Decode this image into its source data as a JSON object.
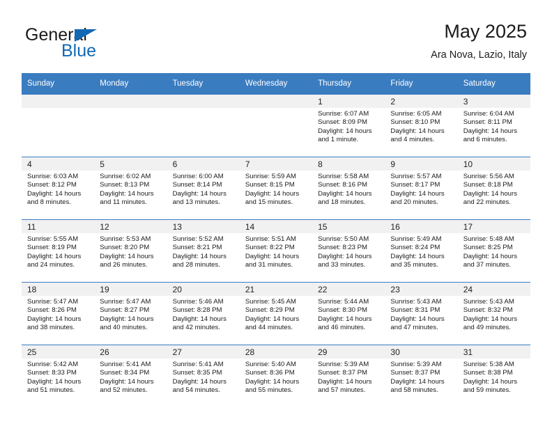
{
  "brand": {
    "name_top": "General",
    "name_bottom": "Blue",
    "accent_color": "#1368b4"
  },
  "header": {
    "title": "May 2025",
    "subtitle": "Ara Nova, Lazio, Italy"
  },
  "theme": {
    "header_bar_color": "#3a7cc0",
    "daynum_band_color": "#f1f1f1",
    "grid_line_color": "#3a7cc0"
  },
  "weekday_headers": [
    "Sunday",
    "Monday",
    "Tuesday",
    "Wednesday",
    "Thursday",
    "Friday",
    "Saturday"
  ],
  "weeks": [
    [
      {
        "day": "",
        "sunrise": "",
        "sunset": "",
        "daylight_line1": "",
        "daylight_line2": "",
        "empty": true
      },
      {
        "day": "",
        "sunrise": "",
        "sunset": "",
        "daylight_line1": "",
        "daylight_line2": "",
        "empty": true
      },
      {
        "day": "",
        "sunrise": "",
        "sunset": "",
        "daylight_line1": "",
        "daylight_line2": "",
        "empty": true
      },
      {
        "day": "",
        "sunrise": "",
        "sunset": "",
        "daylight_line1": "",
        "daylight_line2": "",
        "empty": true
      },
      {
        "day": "1",
        "sunrise": "Sunrise: 6:07 AM",
        "sunset": "Sunset: 8:09 PM",
        "daylight_line1": "Daylight: 14 hours",
        "daylight_line2": "and 1 minute.",
        "empty": false
      },
      {
        "day": "2",
        "sunrise": "Sunrise: 6:05 AM",
        "sunset": "Sunset: 8:10 PM",
        "daylight_line1": "Daylight: 14 hours",
        "daylight_line2": "and 4 minutes.",
        "empty": false
      },
      {
        "day": "3",
        "sunrise": "Sunrise: 6:04 AM",
        "sunset": "Sunset: 8:11 PM",
        "daylight_line1": "Daylight: 14 hours",
        "daylight_line2": "and 6 minutes.",
        "empty": false
      }
    ],
    [
      {
        "day": "4",
        "sunrise": "Sunrise: 6:03 AM",
        "sunset": "Sunset: 8:12 PM",
        "daylight_line1": "Daylight: 14 hours",
        "daylight_line2": "and 8 minutes.",
        "empty": false
      },
      {
        "day": "5",
        "sunrise": "Sunrise: 6:02 AM",
        "sunset": "Sunset: 8:13 PM",
        "daylight_line1": "Daylight: 14 hours",
        "daylight_line2": "and 11 minutes.",
        "empty": false
      },
      {
        "day": "6",
        "sunrise": "Sunrise: 6:00 AM",
        "sunset": "Sunset: 8:14 PM",
        "daylight_line1": "Daylight: 14 hours",
        "daylight_line2": "and 13 minutes.",
        "empty": false
      },
      {
        "day": "7",
        "sunrise": "Sunrise: 5:59 AM",
        "sunset": "Sunset: 8:15 PM",
        "daylight_line1": "Daylight: 14 hours",
        "daylight_line2": "and 15 minutes.",
        "empty": false
      },
      {
        "day": "8",
        "sunrise": "Sunrise: 5:58 AM",
        "sunset": "Sunset: 8:16 PM",
        "daylight_line1": "Daylight: 14 hours",
        "daylight_line2": "and 18 minutes.",
        "empty": false
      },
      {
        "day": "9",
        "sunrise": "Sunrise: 5:57 AM",
        "sunset": "Sunset: 8:17 PM",
        "daylight_line1": "Daylight: 14 hours",
        "daylight_line2": "and 20 minutes.",
        "empty": false
      },
      {
        "day": "10",
        "sunrise": "Sunrise: 5:56 AM",
        "sunset": "Sunset: 8:18 PM",
        "daylight_line1": "Daylight: 14 hours",
        "daylight_line2": "and 22 minutes.",
        "empty": false
      }
    ],
    [
      {
        "day": "11",
        "sunrise": "Sunrise: 5:55 AM",
        "sunset": "Sunset: 8:19 PM",
        "daylight_line1": "Daylight: 14 hours",
        "daylight_line2": "and 24 minutes.",
        "empty": false
      },
      {
        "day": "12",
        "sunrise": "Sunrise: 5:53 AM",
        "sunset": "Sunset: 8:20 PM",
        "daylight_line1": "Daylight: 14 hours",
        "daylight_line2": "and 26 minutes.",
        "empty": false
      },
      {
        "day": "13",
        "sunrise": "Sunrise: 5:52 AM",
        "sunset": "Sunset: 8:21 PM",
        "daylight_line1": "Daylight: 14 hours",
        "daylight_line2": "and 28 minutes.",
        "empty": false
      },
      {
        "day": "14",
        "sunrise": "Sunrise: 5:51 AM",
        "sunset": "Sunset: 8:22 PM",
        "daylight_line1": "Daylight: 14 hours",
        "daylight_line2": "and 31 minutes.",
        "empty": false
      },
      {
        "day": "15",
        "sunrise": "Sunrise: 5:50 AM",
        "sunset": "Sunset: 8:23 PM",
        "daylight_line1": "Daylight: 14 hours",
        "daylight_line2": "and 33 minutes.",
        "empty": false
      },
      {
        "day": "16",
        "sunrise": "Sunrise: 5:49 AM",
        "sunset": "Sunset: 8:24 PM",
        "daylight_line1": "Daylight: 14 hours",
        "daylight_line2": "and 35 minutes.",
        "empty": false
      },
      {
        "day": "17",
        "sunrise": "Sunrise: 5:48 AM",
        "sunset": "Sunset: 8:25 PM",
        "daylight_line1": "Daylight: 14 hours",
        "daylight_line2": "and 37 minutes.",
        "empty": false
      }
    ],
    [
      {
        "day": "18",
        "sunrise": "Sunrise: 5:47 AM",
        "sunset": "Sunset: 8:26 PM",
        "daylight_line1": "Daylight: 14 hours",
        "daylight_line2": "and 38 minutes.",
        "empty": false
      },
      {
        "day": "19",
        "sunrise": "Sunrise: 5:47 AM",
        "sunset": "Sunset: 8:27 PM",
        "daylight_line1": "Daylight: 14 hours",
        "daylight_line2": "and 40 minutes.",
        "empty": false
      },
      {
        "day": "20",
        "sunrise": "Sunrise: 5:46 AM",
        "sunset": "Sunset: 8:28 PM",
        "daylight_line1": "Daylight: 14 hours",
        "daylight_line2": "and 42 minutes.",
        "empty": false
      },
      {
        "day": "21",
        "sunrise": "Sunrise: 5:45 AM",
        "sunset": "Sunset: 8:29 PM",
        "daylight_line1": "Daylight: 14 hours",
        "daylight_line2": "and 44 minutes.",
        "empty": false
      },
      {
        "day": "22",
        "sunrise": "Sunrise: 5:44 AM",
        "sunset": "Sunset: 8:30 PM",
        "daylight_line1": "Daylight: 14 hours",
        "daylight_line2": "and 46 minutes.",
        "empty": false
      },
      {
        "day": "23",
        "sunrise": "Sunrise: 5:43 AM",
        "sunset": "Sunset: 8:31 PM",
        "daylight_line1": "Daylight: 14 hours",
        "daylight_line2": "and 47 minutes.",
        "empty": false
      },
      {
        "day": "24",
        "sunrise": "Sunrise: 5:43 AM",
        "sunset": "Sunset: 8:32 PM",
        "daylight_line1": "Daylight: 14 hours",
        "daylight_line2": "and 49 minutes.",
        "empty": false
      }
    ],
    [
      {
        "day": "25",
        "sunrise": "Sunrise: 5:42 AM",
        "sunset": "Sunset: 8:33 PM",
        "daylight_line1": "Daylight: 14 hours",
        "daylight_line2": "and 51 minutes.",
        "empty": false
      },
      {
        "day": "26",
        "sunrise": "Sunrise: 5:41 AM",
        "sunset": "Sunset: 8:34 PM",
        "daylight_line1": "Daylight: 14 hours",
        "daylight_line2": "and 52 minutes.",
        "empty": false
      },
      {
        "day": "27",
        "sunrise": "Sunrise: 5:41 AM",
        "sunset": "Sunset: 8:35 PM",
        "daylight_line1": "Daylight: 14 hours",
        "daylight_line2": "and 54 minutes.",
        "empty": false
      },
      {
        "day": "28",
        "sunrise": "Sunrise: 5:40 AM",
        "sunset": "Sunset: 8:36 PM",
        "daylight_line1": "Daylight: 14 hours",
        "daylight_line2": "and 55 minutes.",
        "empty": false
      },
      {
        "day": "29",
        "sunrise": "Sunrise: 5:39 AM",
        "sunset": "Sunset: 8:37 PM",
        "daylight_line1": "Daylight: 14 hours",
        "daylight_line2": "and 57 minutes.",
        "empty": false
      },
      {
        "day": "30",
        "sunrise": "Sunrise: 5:39 AM",
        "sunset": "Sunset: 8:37 PM",
        "daylight_line1": "Daylight: 14 hours",
        "daylight_line2": "and 58 minutes.",
        "empty": false
      },
      {
        "day": "31",
        "sunrise": "Sunrise: 5:38 AM",
        "sunset": "Sunset: 8:38 PM",
        "daylight_line1": "Daylight: 14 hours",
        "daylight_line2": "and 59 minutes.",
        "empty": false
      }
    ]
  ]
}
